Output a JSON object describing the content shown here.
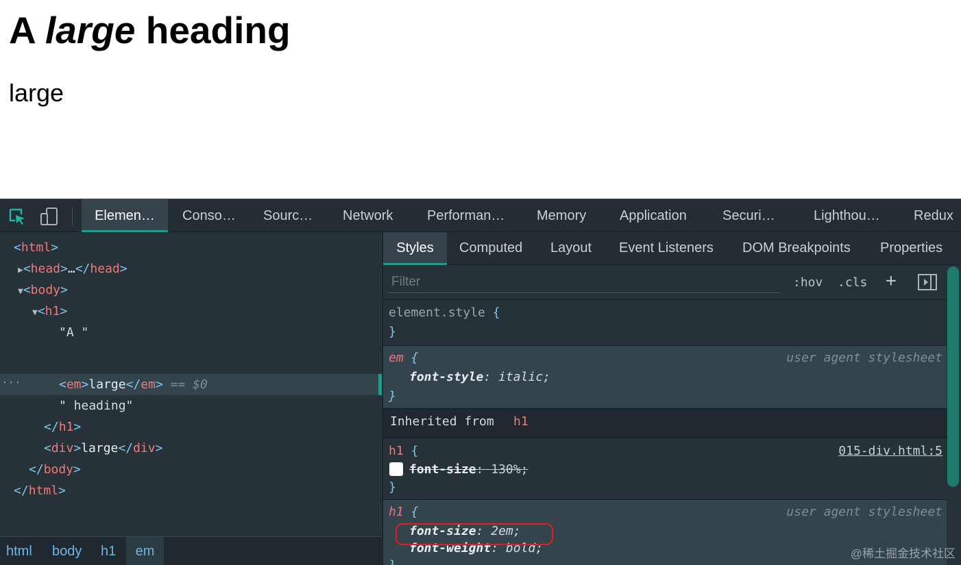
{
  "page": {
    "h1_part1": "A ",
    "h1_em": "large",
    "h1_part2": " heading",
    "div_text": "large"
  },
  "devtools": {
    "tabs": [
      "Elemen…",
      "Conso…",
      "Sourc…",
      "Network",
      "Performan…",
      "Memory",
      "Application",
      "Securi…",
      "Lighthou…",
      "Redux"
    ],
    "active_tab": "Elemen…",
    "dom": {
      "html_open": "html",
      "head": "head",
      "head_ellipsis": "…",
      "body": "body",
      "h1": "h1",
      "text_a": "\"A \"",
      "em": "em",
      "em_text": "large",
      "selected_marker": "== $0",
      "text_heading": "\" heading\"",
      "div": "div",
      "div_text": "large",
      "dots": "···"
    },
    "breadcrumbs": [
      "html",
      "body",
      "h1",
      "em"
    ],
    "subtabs": [
      "Styles",
      "Computed",
      "Layout",
      "Event Listeners",
      "DOM Breakpoints",
      "Properties"
    ],
    "filter": {
      "placeholder": "Filter",
      "hov": ":hov",
      "cls": ".cls",
      "plus": "+"
    },
    "rules": {
      "element_style": "element.style",
      "open_brace": "{",
      "close_brace": "}",
      "em_selector": "em",
      "user_agent": "user agent stylesheet",
      "font_style_prop": "font-style",
      "font_style_val": "italic;",
      "inherited_label": "Inherited from",
      "inherited_tag": "h1",
      "h1_selector": "h1",
      "source": "015-div.html:5",
      "font_size_prop": "font-size",
      "font_size_130": "130%;",
      "font_size_2em": "2em;",
      "font_weight_prop": "font-weight",
      "font_weight_val": "bold;",
      "colon": ": "
    }
  },
  "watermark": "@稀土掘金技术社区",
  "colors": {
    "devtools_bg": "#242d33",
    "accent_teal": "#1f9a8a",
    "tag_red": "#f2777a",
    "bracket_blue": "#7ec8f0",
    "highlight_red": "#e02020"
  }
}
